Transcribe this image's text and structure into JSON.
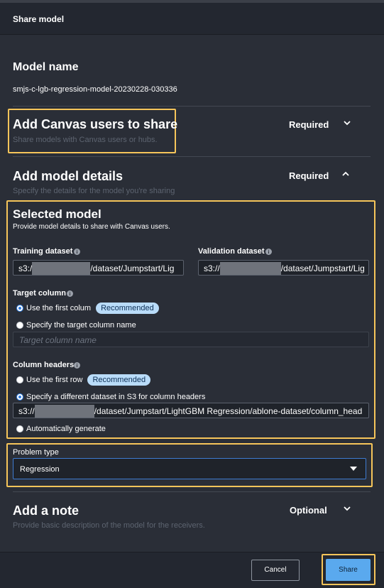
{
  "dialog": {
    "title": "Share model"
  },
  "model_name": {
    "heading": "Model name",
    "value": "smjs-c-lgb-regression-model-20230228-030336"
  },
  "canvas_users": {
    "heading": "Add Canvas users to share",
    "subtitle": "Share models with Canvas users or hubs.",
    "status": "Required"
  },
  "model_details": {
    "heading": "Add model details",
    "subtitle": "Specify the details for the model you're sharing",
    "status": "Required"
  },
  "selected_model": {
    "heading": "Selected model",
    "subtitle": "Provide model details to share with Canvas users.",
    "training_label": "Training dataset",
    "training_prefix": "s3:/",
    "training_suffix": "/dataset/Jumpstart/Lig",
    "validation_label": "Validation dataset",
    "validation_prefix": "s3://",
    "validation_suffix": "/dataset/Jumpstart/Lig",
    "target_label": "Target column",
    "target_option_first": "Use the first colum",
    "target_option_first_badge": "Recommended",
    "target_option_specify": "Specify the target column name",
    "target_placeholder": "Target column name",
    "headers_label": "Column headers",
    "headers_option_first": "Use the first row",
    "headers_option_first_badge": "Recommended",
    "headers_option_s3": "Specify a different dataset in S3 for column headers",
    "headers_prefix": "s3://",
    "headers_suffix": "/dataset/Jumpstart/LightGBM Regression/ablone-dataset/column_head",
    "headers_option_auto": "Automatically generate"
  },
  "problem_type": {
    "label": "Problem type",
    "value": "Regression"
  },
  "note": {
    "heading": "Add a note",
    "subtitle": "Provide basic description of the model for the receivers.",
    "status": "Optional"
  },
  "footer": {
    "cancel_label": "Cancel",
    "share_label": "Share"
  },
  "colors": {
    "background": "#2a2e37",
    "highlight": "#f6c55a",
    "accent": "#5aa9ee",
    "badge": "#b9dcf9"
  }
}
